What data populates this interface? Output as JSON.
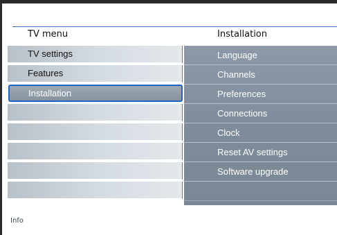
{
  "header": {
    "left_title": "TV menu",
    "right_title": "Installation"
  },
  "left_menu": {
    "items": [
      {
        "label": "TV settings",
        "selected": false
      },
      {
        "label": "Features",
        "selected": false
      },
      {
        "label": "Installation",
        "selected": true
      },
      {
        "label": "",
        "selected": false
      },
      {
        "label": "",
        "selected": false
      },
      {
        "label": "",
        "selected": false
      },
      {
        "label": "",
        "selected": false
      },
      {
        "label": "",
        "selected": false
      }
    ]
  },
  "right_menu": {
    "items": [
      {
        "label": "Language"
      },
      {
        "label": "Channels"
      },
      {
        "label": "Preferences"
      },
      {
        "label": "Connections"
      },
      {
        "label": "Clock"
      },
      {
        "label": "Reset AV settings"
      },
      {
        "label": "Software upgrade"
      }
    ]
  },
  "footer": {
    "info_label": "Info"
  },
  "colors": {
    "accent_blue": "#1f64c8",
    "header_line": "#3b73c4",
    "right_panel": "#8391a0",
    "left_panel": "#d5dce2"
  }
}
